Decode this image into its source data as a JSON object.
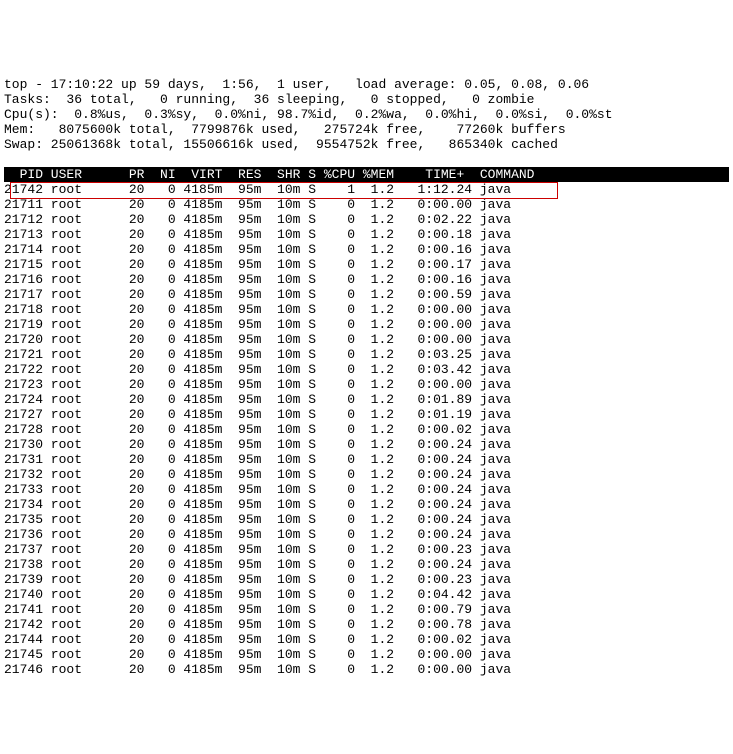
{
  "summary": {
    "line1": "top - 17:10:22 up 59 days,  1:56,  1 user,   load average: 0.05, 0.08, 0.06",
    "line2": "Tasks:  36 total,   0 running,  36 sleeping,   0 stopped,   0 zombie",
    "line3": "Cpu(s):  0.8%us,  0.3%sy,  0.0%ni, 98.7%id,  0.2%wa,  0.0%hi,  0.0%si,  0.0%st",
    "line4": "Mem:   8075600k total,  7799876k used,   275724k free,    77260k buffers",
    "line5": "Swap: 25061368k total, 15506616k used,  9554752k free,   865340k cached"
  },
  "columns": [
    "PID",
    "USER",
    "PR",
    "NI",
    "VIRT",
    "RES",
    "SHR",
    "S",
    "%CPU",
    "%MEM",
    "TIME+",
    "COMMAND"
  ],
  "header_line": "  PID USER      PR  NI  VIRT  RES  SHR S %CPU %MEM    TIME+  COMMAND         ",
  "highlight_pid": 21742,
  "processes": [
    {
      "pid": 21742,
      "user": "root",
      "pr": 20,
      "ni": 0,
      "virt": "4185m",
      "res": "95m",
      "shr": "10m",
      "s": "S",
      "cpu": "1",
      "mem": "1.2",
      "time": "1:12.24",
      "cmd": "java"
    },
    {
      "pid": 21711,
      "user": "root",
      "pr": 20,
      "ni": 0,
      "virt": "4185m",
      "res": "95m",
      "shr": "10m",
      "s": "S",
      "cpu": "0",
      "mem": "1.2",
      "time": "0:00.00",
      "cmd": "java"
    },
    {
      "pid": 21712,
      "user": "root",
      "pr": 20,
      "ni": 0,
      "virt": "4185m",
      "res": "95m",
      "shr": "10m",
      "s": "S",
      "cpu": "0",
      "mem": "1.2",
      "time": "0:02.22",
      "cmd": "java"
    },
    {
      "pid": 21713,
      "user": "root",
      "pr": 20,
      "ni": 0,
      "virt": "4185m",
      "res": "95m",
      "shr": "10m",
      "s": "S",
      "cpu": "0",
      "mem": "1.2",
      "time": "0:00.18",
      "cmd": "java"
    },
    {
      "pid": 21714,
      "user": "root",
      "pr": 20,
      "ni": 0,
      "virt": "4185m",
      "res": "95m",
      "shr": "10m",
      "s": "S",
      "cpu": "0",
      "mem": "1.2",
      "time": "0:00.16",
      "cmd": "java"
    },
    {
      "pid": 21715,
      "user": "root",
      "pr": 20,
      "ni": 0,
      "virt": "4185m",
      "res": "95m",
      "shr": "10m",
      "s": "S",
      "cpu": "0",
      "mem": "1.2",
      "time": "0:00.17",
      "cmd": "java"
    },
    {
      "pid": 21716,
      "user": "root",
      "pr": 20,
      "ni": 0,
      "virt": "4185m",
      "res": "95m",
      "shr": "10m",
      "s": "S",
      "cpu": "0",
      "mem": "1.2",
      "time": "0:00.16",
      "cmd": "java"
    },
    {
      "pid": 21717,
      "user": "root",
      "pr": 20,
      "ni": 0,
      "virt": "4185m",
      "res": "95m",
      "shr": "10m",
      "s": "S",
      "cpu": "0",
      "mem": "1.2",
      "time": "0:00.59",
      "cmd": "java"
    },
    {
      "pid": 21718,
      "user": "root",
      "pr": 20,
      "ni": 0,
      "virt": "4185m",
      "res": "95m",
      "shr": "10m",
      "s": "S",
      "cpu": "0",
      "mem": "1.2",
      "time": "0:00.00",
      "cmd": "java"
    },
    {
      "pid": 21719,
      "user": "root",
      "pr": 20,
      "ni": 0,
      "virt": "4185m",
      "res": "95m",
      "shr": "10m",
      "s": "S",
      "cpu": "0",
      "mem": "1.2",
      "time": "0:00.00",
      "cmd": "java"
    },
    {
      "pid": 21720,
      "user": "root",
      "pr": 20,
      "ni": 0,
      "virt": "4185m",
      "res": "95m",
      "shr": "10m",
      "s": "S",
      "cpu": "0",
      "mem": "1.2",
      "time": "0:00.00",
      "cmd": "java"
    },
    {
      "pid": 21721,
      "user": "root",
      "pr": 20,
      "ni": 0,
      "virt": "4185m",
      "res": "95m",
      "shr": "10m",
      "s": "S",
      "cpu": "0",
      "mem": "1.2",
      "time": "0:03.25",
      "cmd": "java"
    },
    {
      "pid": 21722,
      "user": "root",
      "pr": 20,
      "ni": 0,
      "virt": "4185m",
      "res": "95m",
      "shr": "10m",
      "s": "S",
      "cpu": "0",
      "mem": "1.2",
      "time": "0:03.42",
      "cmd": "java"
    },
    {
      "pid": 21723,
      "user": "root",
      "pr": 20,
      "ni": 0,
      "virt": "4185m",
      "res": "95m",
      "shr": "10m",
      "s": "S",
      "cpu": "0",
      "mem": "1.2",
      "time": "0:00.00",
      "cmd": "java"
    },
    {
      "pid": 21724,
      "user": "root",
      "pr": 20,
      "ni": 0,
      "virt": "4185m",
      "res": "95m",
      "shr": "10m",
      "s": "S",
      "cpu": "0",
      "mem": "1.2",
      "time": "0:01.89",
      "cmd": "java"
    },
    {
      "pid": 21727,
      "user": "root",
      "pr": 20,
      "ni": 0,
      "virt": "4185m",
      "res": "95m",
      "shr": "10m",
      "s": "S",
      "cpu": "0",
      "mem": "1.2",
      "time": "0:01.19",
      "cmd": "java"
    },
    {
      "pid": 21728,
      "user": "root",
      "pr": 20,
      "ni": 0,
      "virt": "4185m",
      "res": "95m",
      "shr": "10m",
      "s": "S",
      "cpu": "0",
      "mem": "1.2",
      "time": "0:00.02",
      "cmd": "java"
    },
    {
      "pid": 21730,
      "user": "root",
      "pr": 20,
      "ni": 0,
      "virt": "4185m",
      "res": "95m",
      "shr": "10m",
      "s": "S",
      "cpu": "0",
      "mem": "1.2",
      "time": "0:00.24",
      "cmd": "java"
    },
    {
      "pid": 21731,
      "user": "root",
      "pr": 20,
      "ni": 0,
      "virt": "4185m",
      "res": "95m",
      "shr": "10m",
      "s": "S",
      "cpu": "0",
      "mem": "1.2",
      "time": "0:00.24",
      "cmd": "java"
    },
    {
      "pid": 21732,
      "user": "root",
      "pr": 20,
      "ni": 0,
      "virt": "4185m",
      "res": "95m",
      "shr": "10m",
      "s": "S",
      "cpu": "0",
      "mem": "1.2",
      "time": "0:00.24",
      "cmd": "java"
    },
    {
      "pid": 21733,
      "user": "root",
      "pr": 20,
      "ni": 0,
      "virt": "4185m",
      "res": "95m",
      "shr": "10m",
      "s": "S",
      "cpu": "0",
      "mem": "1.2",
      "time": "0:00.24",
      "cmd": "java"
    },
    {
      "pid": 21734,
      "user": "root",
      "pr": 20,
      "ni": 0,
      "virt": "4185m",
      "res": "95m",
      "shr": "10m",
      "s": "S",
      "cpu": "0",
      "mem": "1.2",
      "time": "0:00.24",
      "cmd": "java"
    },
    {
      "pid": 21735,
      "user": "root",
      "pr": 20,
      "ni": 0,
      "virt": "4185m",
      "res": "95m",
      "shr": "10m",
      "s": "S",
      "cpu": "0",
      "mem": "1.2",
      "time": "0:00.24",
      "cmd": "java"
    },
    {
      "pid": 21736,
      "user": "root",
      "pr": 20,
      "ni": 0,
      "virt": "4185m",
      "res": "95m",
      "shr": "10m",
      "s": "S",
      "cpu": "0",
      "mem": "1.2",
      "time": "0:00.24",
      "cmd": "java"
    },
    {
      "pid": 21737,
      "user": "root",
      "pr": 20,
      "ni": 0,
      "virt": "4185m",
      "res": "95m",
      "shr": "10m",
      "s": "S",
      "cpu": "0",
      "mem": "1.2",
      "time": "0:00.23",
      "cmd": "java"
    },
    {
      "pid": 21738,
      "user": "root",
      "pr": 20,
      "ni": 0,
      "virt": "4185m",
      "res": "95m",
      "shr": "10m",
      "s": "S",
      "cpu": "0",
      "mem": "1.2",
      "time": "0:00.24",
      "cmd": "java"
    },
    {
      "pid": 21739,
      "user": "root",
      "pr": 20,
      "ni": 0,
      "virt": "4185m",
      "res": "95m",
      "shr": "10m",
      "s": "S",
      "cpu": "0",
      "mem": "1.2",
      "time": "0:00.23",
      "cmd": "java"
    },
    {
      "pid": 21740,
      "user": "root",
      "pr": 20,
      "ni": 0,
      "virt": "4185m",
      "res": "95m",
      "shr": "10m",
      "s": "S",
      "cpu": "0",
      "mem": "1.2",
      "time": "0:04.42",
      "cmd": "java"
    },
    {
      "pid": 21741,
      "user": "root",
      "pr": 20,
      "ni": 0,
      "virt": "4185m",
      "res": "95m",
      "shr": "10m",
      "s": "S",
      "cpu": "0",
      "mem": "1.2",
      "time": "0:00.79",
      "cmd": "java"
    },
    {
      "pid": 21742,
      "user": "root",
      "pr": 20,
      "ni": 0,
      "virt": "4185m",
      "res": "95m",
      "shr": "10m",
      "s": "S",
      "cpu": "0",
      "mem": "1.2",
      "time": "0:00.78",
      "cmd": "java"
    },
    {
      "pid": 21744,
      "user": "root",
      "pr": 20,
      "ni": 0,
      "virt": "4185m",
      "res": "95m",
      "shr": "10m",
      "s": "S",
      "cpu": "0",
      "mem": "1.2",
      "time": "0:00.02",
      "cmd": "java"
    },
    {
      "pid": 21745,
      "user": "root",
      "pr": 20,
      "ni": 0,
      "virt": "4185m",
      "res": "95m",
      "shr": "10m",
      "s": "S",
      "cpu": "0",
      "mem": "1.2",
      "time": "0:00.00",
      "cmd": "java"
    },
    {
      "pid": 21746,
      "user": "root",
      "pr": 20,
      "ni": 0,
      "virt": "4185m",
      "res": "95m",
      "shr": "10m",
      "s": "S",
      "cpu": "0",
      "mem": "1.2",
      "time": "0:00.00",
      "cmd": "java"
    }
  ]
}
